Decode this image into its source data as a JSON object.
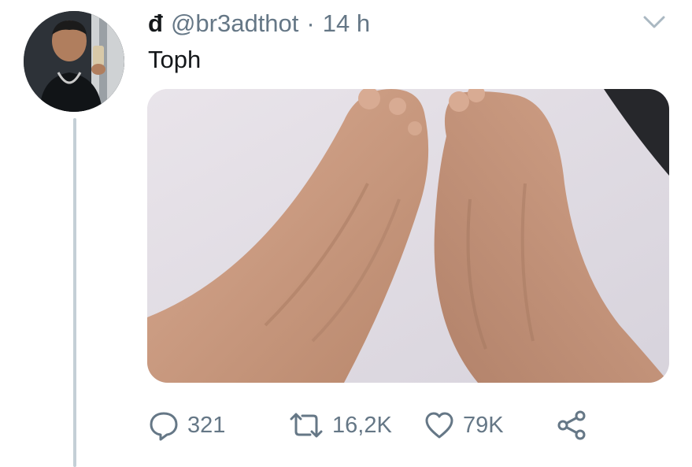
{
  "tweet": {
    "display_name": "đ",
    "handle": "@br3adthot",
    "separator": "·",
    "time": "14 h",
    "text": "Toph"
  },
  "actions": {
    "reply_count": "321",
    "retweet_count": "16,2K",
    "like_count": "79K"
  },
  "icons": {
    "menu": "chevron-down-icon",
    "reply": "speech-bubble-icon",
    "retweet": "retweet-arrows-icon",
    "like": "heart-icon",
    "share": "share-icon"
  },
  "colors": {
    "text": "#14171a",
    "secondary": "#657786",
    "thread_line": "#c4cfd6"
  }
}
